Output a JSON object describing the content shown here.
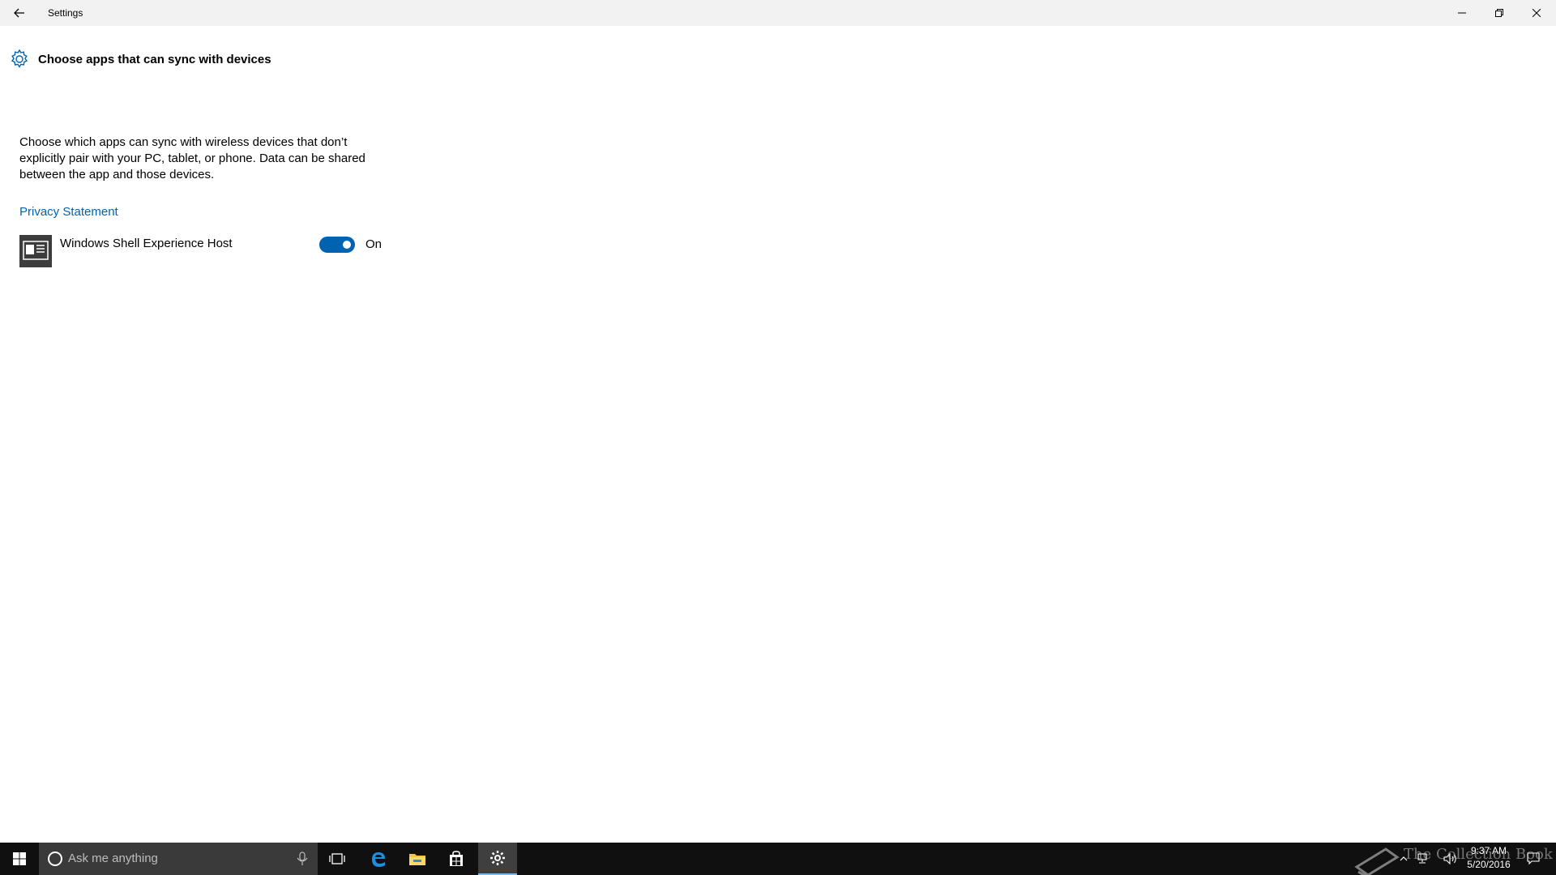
{
  "window": {
    "title": "Settings"
  },
  "page": {
    "title": "Choose apps that can sync with devices",
    "description": "Choose which apps can sync with wireless devices that don’t explicitly pair with your PC, tablet, or phone. Data can be shared between the app and those devices.",
    "privacy_link": "Privacy Statement"
  },
  "apps": [
    {
      "name": "Windows Shell Experience Host",
      "toggle_on": true,
      "toggle_label": "On"
    }
  ],
  "taskbar": {
    "search_placeholder": "Ask me anything",
    "pinned": [
      "task-view",
      "edge",
      "file-explorer",
      "store",
      "settings"
    ],
    "active": "settings",
    "clock_time": "9:37 AM",
    "clock_date": "5/20/2016"
  },
  "watermark": "The Collection Book",
  "colors": {
    "accent": "#0063b1",
    "titlebar": "#f2f2f2",
    "taskbar": "#101010"
  }
}
